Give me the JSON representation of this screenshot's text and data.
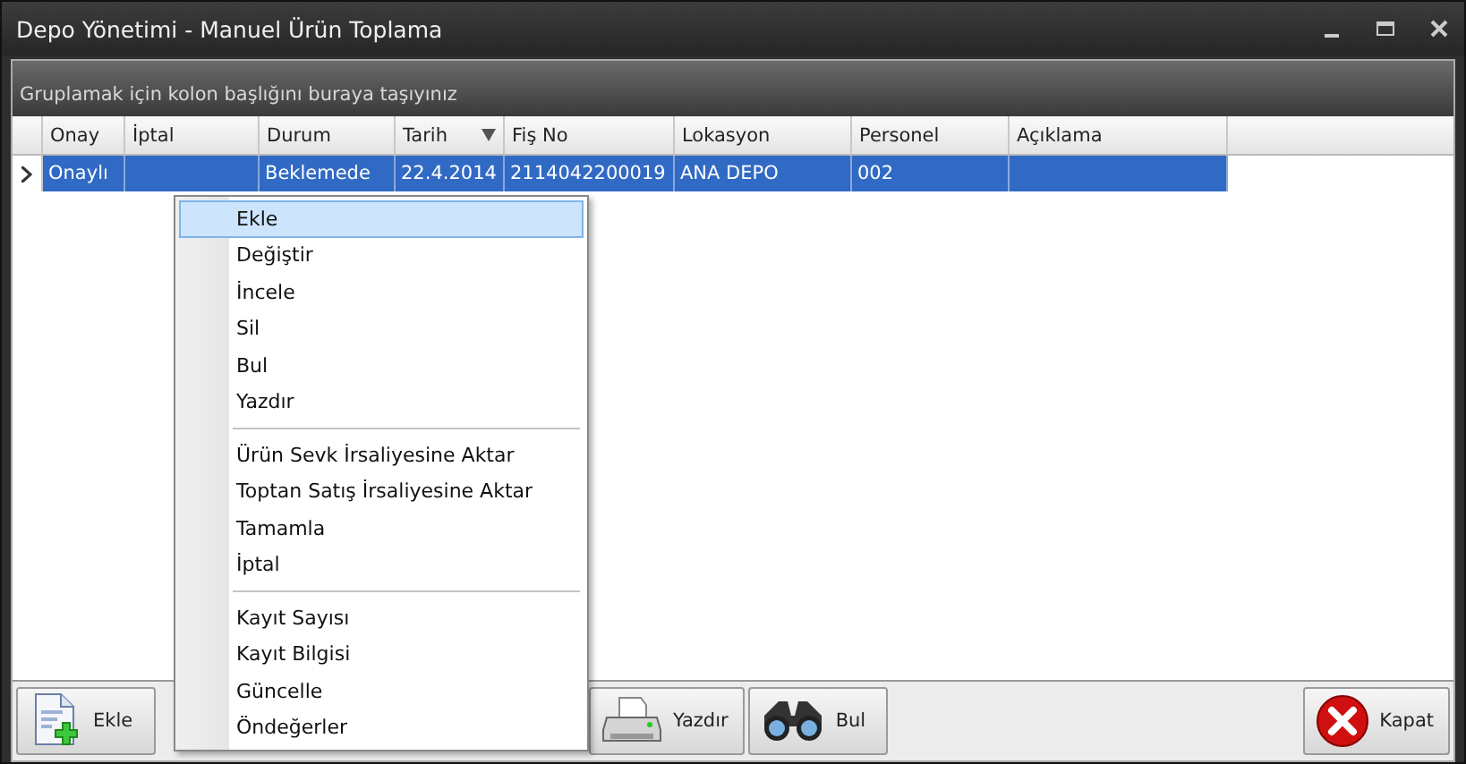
{
  "window": {
    "title": "Depo Yönetimi - Manuel Ürün Toplama"
  },
  "group_panel": {
    "text": "Gruplamak için kolon başlığını buraya taşıyınız"
  },
  "grid": {
    "columns": [
      {
        "label": "Onay",
        "sorted": false
      },
      {
        "label": "İptal",
        "sorted": false
      },
      {
        "label": "Durum",
        "sorted": false
      },
      {
        "label": "Tarih",
        "sorted": true
      },
      {
        "label": "Fiş No",
        "sorted": false
      },
      {
        "label": "Lokasyon",
        "sorted": false
      },
      {
        "label": "Personel",
        "sorted": false
      },
      {
        "label": "Açıklama",
        "sorted": false
      }
    ],
    "rows": [
      {
        "selected": true,
        "cells": [
          "Onaylı",
          null,
          "Beklemede",
          "22.4.2014",
          "2114042200019",
          "ANA DEPO",
          "002",
          null
        ]
      }
    ]
  },
  "context_menu": {
    "groups": [
      [
        {
          "label": "Ekle",
          "highlighted": true
        },
        {
          "label": "Değiştir",
          "highlighted": false
        },
        {
          "label": "İncele",
          "highlighted": false
        },
        {
          "label": "Sil",
          "highlighted": false
        },
        {
          "label": "Bul",
          "highlighted": false
        },
        {
          "label": "Yazdır",
          "highlighted": false
        }
      ],
      [
        {
          "label": "Ürün Sevk İrsaliyesine Aktar",
          "highlighted": false
        },
        {
          "label": "Toptan Satış İrsaliyesine Aktar",
          "highlighted": false
        },
        {
          "label": "Tamamla",
          "highlighted": false
        },
        {
          "label": "İptal",
          "highlighted": false
        }
      ],
      [
        {
          "label": "Kayıt Sayısı",
          "highlighted": false
        },
        {
          "label": "Kayıt Bilgisi",
          "highlighted": false
        },
        {
          "label": "Güncelle",
          "highlighted": false
        },
        {
          "label": "Öndeğerler",
          "highlighted": false
        }
      ]
    ]
  },
  "toolbar": {
    "buttons": [
      {
        "label": "Ekle",
        "kind": "add"
      },
      {
        "label": "Yazdır",
        "kind": "print"
      },
      {
        "label": "Bul",
        "kind": "find"
      },
      {
        "label": "Kapat",
        "kind": "close"
      }
    ]
  }
}
